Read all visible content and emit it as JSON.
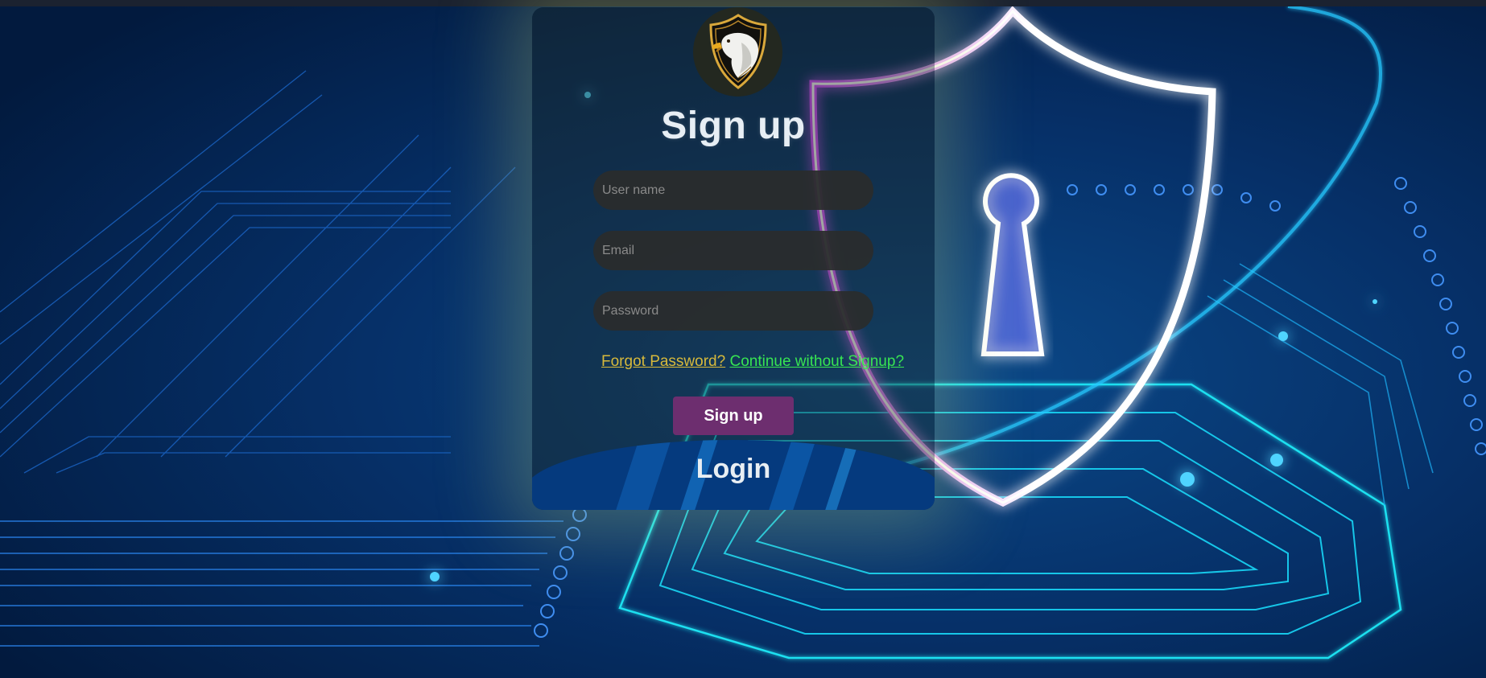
{
  "logo": {
    "icon": "eagle-shield-icon"
  },
  "form": {
    "title": "Sign up",
    "username_placeholder": "User name",
    "email_placeholder": "Email",
    "password_placeholder": "Password",
    "forgot_link": "Forgot Password?",
    "continue_link": "Continue without Signup?",
    "submit_label": "Sign up",
    "login_label": "Login"
  },
  "colors": {
    "accent_button": "#6d2e6f",
    "forgot_link": "#d7b93b",
    "continue_link": "#37e552",
    "background": "#031a3d"
  },
  "background_art": {
    "icon": "shield-keyhole-circuit-icon"
  }
}
